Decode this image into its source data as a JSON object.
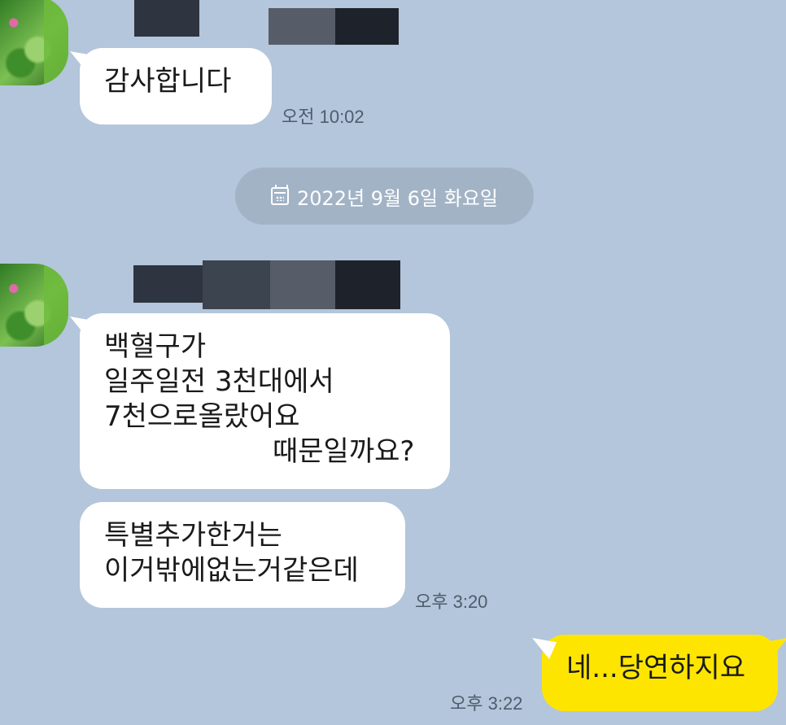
{
  "messages": {
    "m1_text": "감사합니다",
    "m1_time": "오전 10:02",
    "date_divider": "2022년 9월 6일 화요일",
    "m2_lines": [
      "백혈구가",
      "일주일전 3천대에서",
      "7천으로올랐어요",
      "때문일까요?"
    ],
    "m3_lines": [
      "특별추가한거는",
      "이거밖에없는거같은데"
    ],
    "m3_time": "오후 3:20",
    "m4_text": "네...당연하지요",
    "m4_time": "오후 3:22"
  },
  "icons": {
    "calendar": "calendar-icon",
    "avatar": "avatar"
  },
  "colors": {
    "background": "#b3c6db",
    "incoming_bubble": "#ffffff",
    "outgoing_bubble": "#fee500",
    "date_pill": "#a2b3c6"
  }
}
